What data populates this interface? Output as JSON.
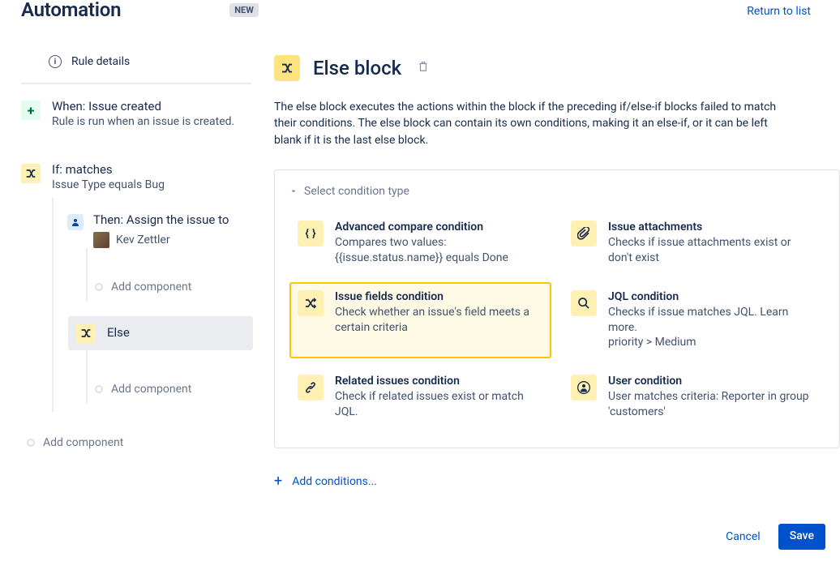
{
  "header": {
    "title": "Automation",
    "badge": "NEW",
    "return_link": "Return to list"
  },
  "sidebar": {
    "rule_details": "Rule details",
    "trigger": {
      "title": "When: Issue created",
      "desc": "Rule is run when an issue is created."
    },
    "if_block": {
      "title": "If: matches",
      "desc": "Issue Type equals Bug",
      "then": {
        "title": "Then: Assign the issue to",
        "assignee": "Kev Zettler"
      },
      "add_component": "Add component"
    },
    "else_block": {
      "title": "Else",
      "add_component": "Add component"
    },
    "add_component_root": "Add component"
  },
  "detail": {
    "title": "Else block",
    "description": "The else block executes the actions within the block if the preceding if/else-if blocks failed to match their conditions. The else block can contain its own conditions, making it an else-if, or it can be left blank if it is the last else block.",
    "collapse_label": "Select condition type",
    "conditions": [
      {
        "title": "Advanced compare condition",
        "desc": "Compares two values: {{issue.status.name}} equals Done"
      },
      {
        "title": "Issue attachments",
        "desc": "Checks if issue attachments exist or don't exist"
      },
      {
        "title": "Issue fields condition",
        "desc": "Check whether an issue's field meets a certain criteria"
      },
      {
        "title": "JQL condition",
        "desc": "Checks if issue matches JQL. Learn more.\npriority > Medium"
      },
      {
        "title": "Related issues condition",
        "desc": "Check if related issues exist or match JQL."
      },
      {
        "title": "User condition",
        "desc": "User matches criteria: Reporter in group 'customers'"
      }
    ],
    "add_conditions": "Add conditions...",
    "cancel": "Cancel",
    "save": "Save"
  }
}
